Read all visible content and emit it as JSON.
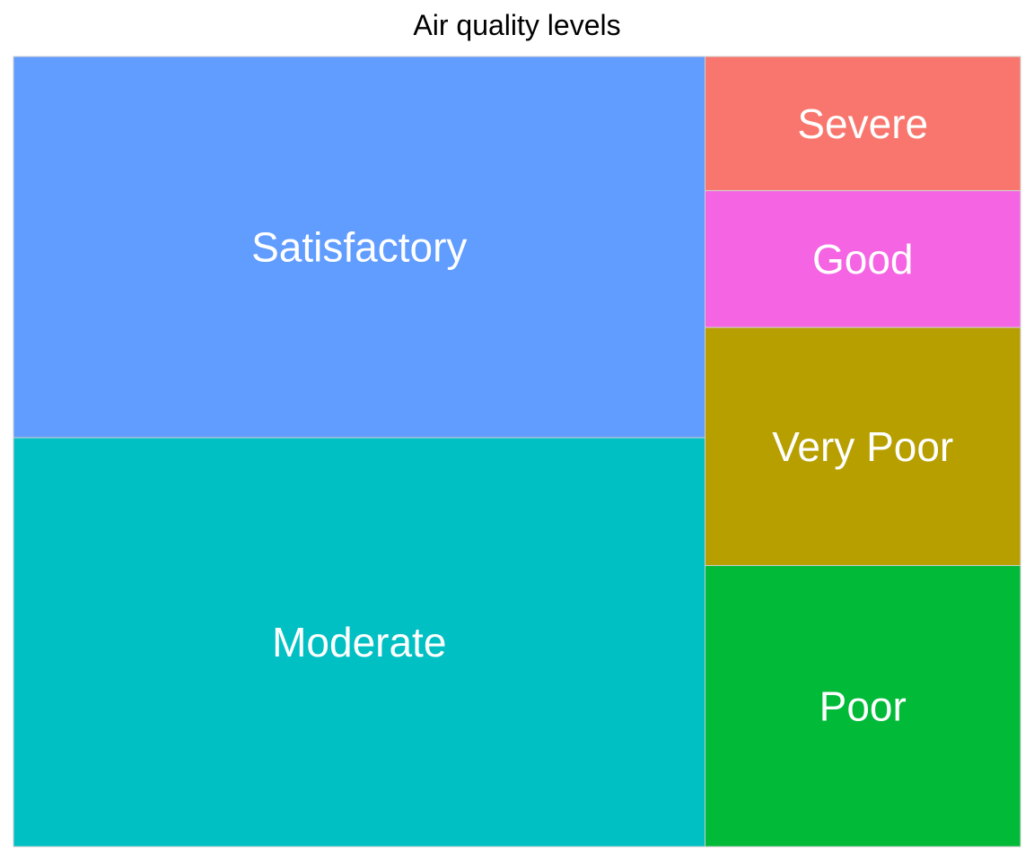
{
  "chart_data": {
    "type": "treemap",
    "title": "Air quality levels",
    "items": [
      {
        "label": "Satisfactory",
        "value": 0.33,
        "color": "#619CFF"
      },
      {
        "label": "Moderate",
        "value": 0.354,
        "color": "#00C0C4"
      },
      {
        "label": "Severe",
        "value": 0.053,
        "color": "#F8766D"
      },
      {
        "label": "Good",
        "value": 0.054,
        "color": "#F564E3"
      },
      {
        "label": "Very Poor",
        "value": 0.094,
        "color": "#B79F00"
      },
      {
        "label": "Poor",
        "value": 0.111,
        "color": "#00BA38"
      }
    ]
  }
}
